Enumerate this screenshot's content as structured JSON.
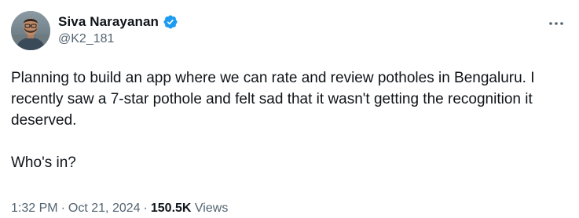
{
  "author": {
    "display_name": "Siva Narayanan",
    "handle": "@K2_181",
    "verified": true
  },
  "icons": {
    "verified": "verified-badge-icon",
    "more": "more-horizontal-icon"
  },
  "colors": {
    "text_primary": "#0f1419",
    "text_secondary": "#536471",
    "verified_blue": "#1d9bf0"
  },
  "tweet": {
    "paragraph_1": "Planning to build an app where we can rate and review potholes in Bengaluru. I recently saw a 7-star pothole and felt sad that it wasn't getting the recognition it deserved.",
    "paragraph_2": "Who's in?"
  },
  "meta": {
    "time": "1:32 PM",
    "separator": "·",
    "date": "Oct 21, 2024",
    "views_count": "150.5K",
    "views_label": "Views"
  }
}
